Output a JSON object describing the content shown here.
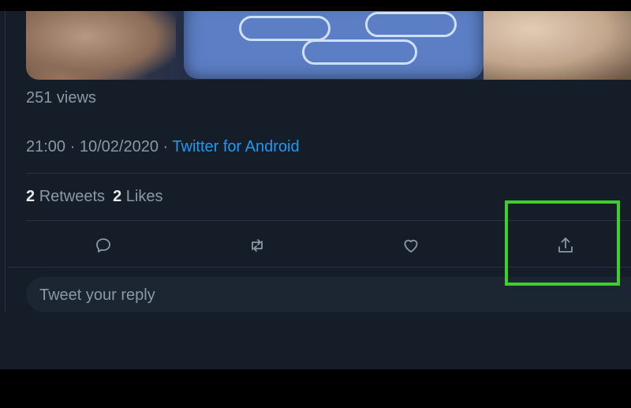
{
  "tweet": {
    "views_label": "251 views",
    "time": "21:00",
    "date": "10/02/2020",
    "separator": "·",
    "source": "Twitter for Android",
    "retweets_count": "2",
    "retweets_label": "Retweets",
    "likes_count": "2",
    "likes_label": "Likes"
  },
  "actions": [
    {
      "name": "reply",
      "icon": "reply-icon"
    },
    {
      "name": "retweet",
      "icon": "retweet-icon"
    },
    {
      "name": "like",
      "icon": "heart-icon"
    },
    {
      "name": "share",
      "icon": "share-icon"
    }
  ],
  "reply_box": {
    "placeholder": "Tweet your reply"
  },
  "colors": {
    "background": "#151d29",
    "text_secondary": "#8b98a5",
    "link": "#1d9bf0",
    "highlight": "#3dd02a"
  }
}
